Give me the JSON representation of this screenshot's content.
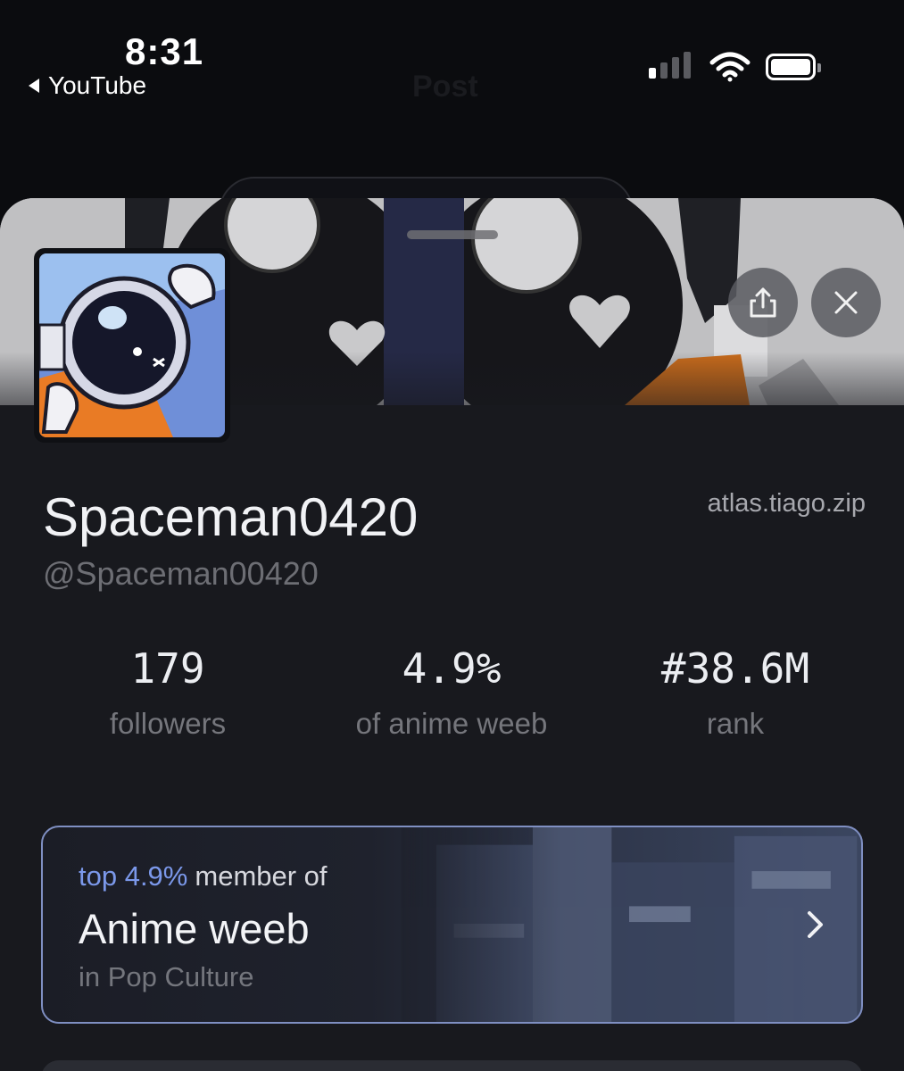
{
  "status_bar": {
    "time": "8:31",
    "back_app": "YouTube",
    "screen_title_ghost": "Post"
  },
  "icons": {
    "share": "share-icon",
    "close": "close-icon",
    "chevron": "chevron-right-icon",
    "back": "back-triangle-icon",
    "wifi": "wifi-icon",
    "battery": "battery-icon",
    "signal": "cellular-signal-icon"
  },
  "profile": {
    "display_name": "Spaceman0420",
    "handle": "@Spaceman00420",
    "site": "atlas.tiago.zip"
  },
  "stats": [
    {
      "value": "179",
      "label": "followers"
    },
    {
      "value": "4.9%",
      "label": "of anime weeb"
    },
    {
      "value": "#38.6M",
      "label": "rank"
    }
  ],
  "community_card": {
    "highlight": "top 4.9%",
    "prefix": "member of",
    "title": "Anime weeb",
    "subtitle": "in Pop Culture"
  },
  "colors": {
    "accent": "#7b98ea",
    "card_border": "#7f8fc2",
    "sheet_bg": "#18191e",
    "muted_text": "#75767c"
  },
  "signal_bars_active": 1,
  "battery_level": 0.95
}
